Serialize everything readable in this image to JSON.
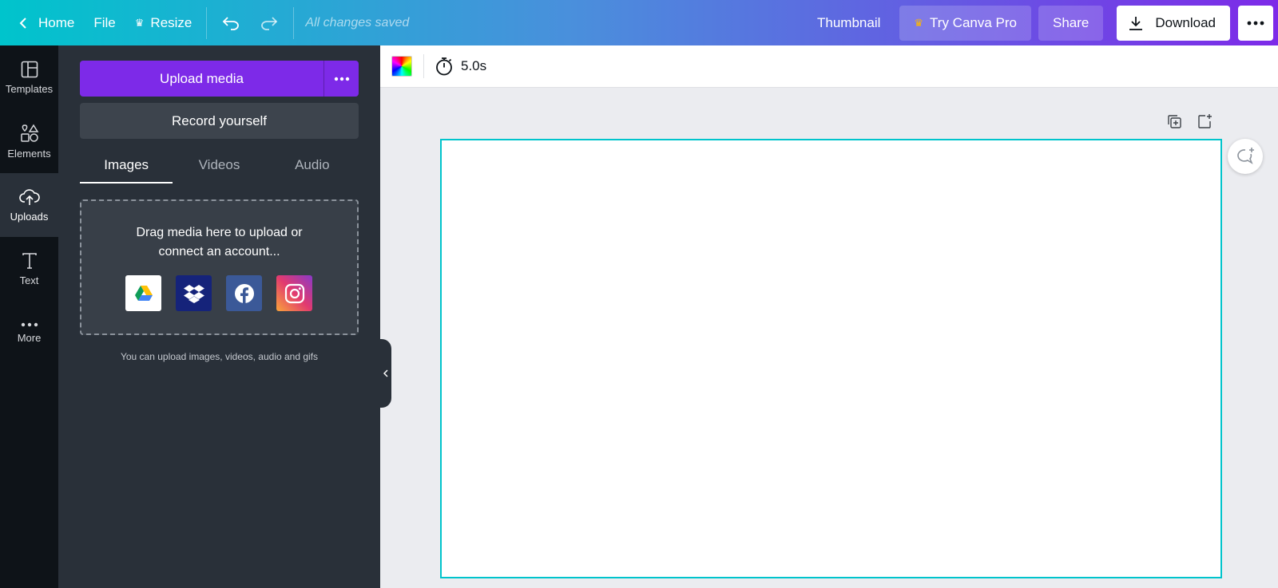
{
  "topbar": {
    "home_label": "Home",
    "file_label": "File",
    "resize_label": "Resize",
    "status_text": "All changes saved",
    "design_title": "Thumbnail",
    "pro_label": "Try Canva Pro",
    "share_label": "Share",
    "download_label": "Download",
    "more_icon": "ellipsis-icon"
  },
  "rail": {
    "items": [
      {
        "label": "Templates",
        "icon": "templates-icon"
      },
      {
        "label": "Elements",
        "icon": "elements-icon"
      },
      {
        "label": "Uploads",
        "icon": "cloud-upload-icon",
        "active": true
      },
      {
        "label": "Text",
        "icon": "text-icon"
      },
      {
        "label": "More",
        "icon": "ellipsis-icon"
      }
    ]
  },
  "panel": {
    "upload_label": "Upload media",
    "record_label": "Record yourself",
    "tabs": [
      {
        "label": "Images",
        "active": true
      },
      {
        "label": "Videos"
      },
      {
        "label": "Audio"
      }
    ],
    "drop_line1": "Drag media here to upload or",
    "drop_line2": "connect an account...",
    "services": [
      "google-drive-icon",
      "dropbox-icon",
      "facebook-icon",
      "instagram-icon"
    ],
    "hint": "You can upload images, videos, audio and gifs"
  },
  "editor": {
    "duration": "5.0s"
  },
  "colors": {
    "accent": "#7d2ae8",
    "canvas_border": "#00c4cc",
    "panel_bg": "#293039",
    "rail_bg": "#0e1318"
  }
}
